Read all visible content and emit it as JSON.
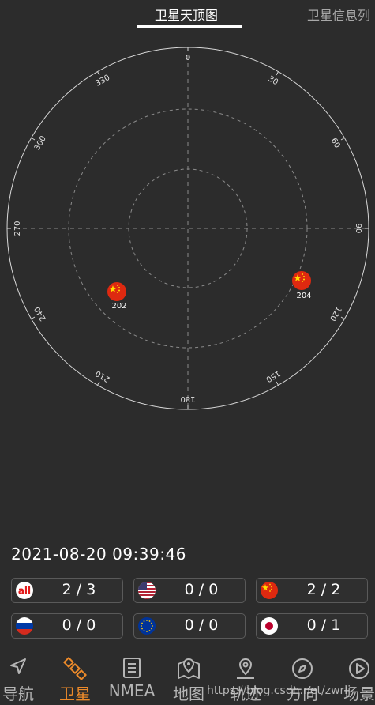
{
  "tabs": [
    {
      "label": "卫星天顶图",
      "active": true
    },
    {
      "label": "卫星信息列",
      "active": false
    }
  ],
  "skyplot": {
    "azimuth_labels": [
      "0",
      "30",
      "60",
      "90",
      "120",
      "150",
      "180",
      "210",
      "240",
      "270",
      "300",
      "330"
    ],
    "satellites": [
      {
        "prn": "202",
        "constellation": "BeiDou",
        "flag": "china-flag-icon"
      },
      {
        "prn": "204",
        "constellation": "BeiDou",
        "flag": "china-flag-icon"
      }
    ]
  },
  "datetime": "2021-08-20  09:39:46",
  "counters": [
    {
      "name": "all",
      "icon": "all-icon",
      "value": "2 / 3"
    },
    {
      "name": "gps",
      "icon": "usa-flag-icon",
      "value": "0 / 0"
    },
    {
      "name": "beidou",
      "icon": "china-flag-icon",
      "value": "2 / 2"
    },
    {
      "name": "glonass",
      "icon": "russia-flag-icon",
      "value": "0 / 0"
    },
    {
      "name": "galileo",
      "icon": "eu-flag-icon",
      "value": "0 / 0"
    },
    {
      "name": "qzss",
      "icon": "japan-flag-icon",
      "value": "0 / 1"
    }
  ],
  "nav": [
    {
      "label": "导航",
      "icon": "navigation-arrow-icon",
      "active": false
    },
    {
      "label": "卫星",
      "icon": "satellite-icon",
      "active": true
    },
    {
      "label": "NMEA",
      "icon": "document-icon",
      "active": false
    },
    {
      "label": "地图",
      "icon": "map-icon",
      "active": false
    },
    {
      "label": "轨迹",
      "icon": "location-pin-icon",
      "active": false
    },
    {
      "label": "方向",
      "icon": "compass-icon",
      "active": false
    },
    {
      "label": "场景",
      "icon": "play-icon",
      "active": false
    }
  ],
  "watermark": "https://blog.csdn.net/zwrlj",
  "colors": {
    "accent": "#ec8a2a",
    "background": "#2c2c2c",
    "border": "#5a5a5a"
  }
}
